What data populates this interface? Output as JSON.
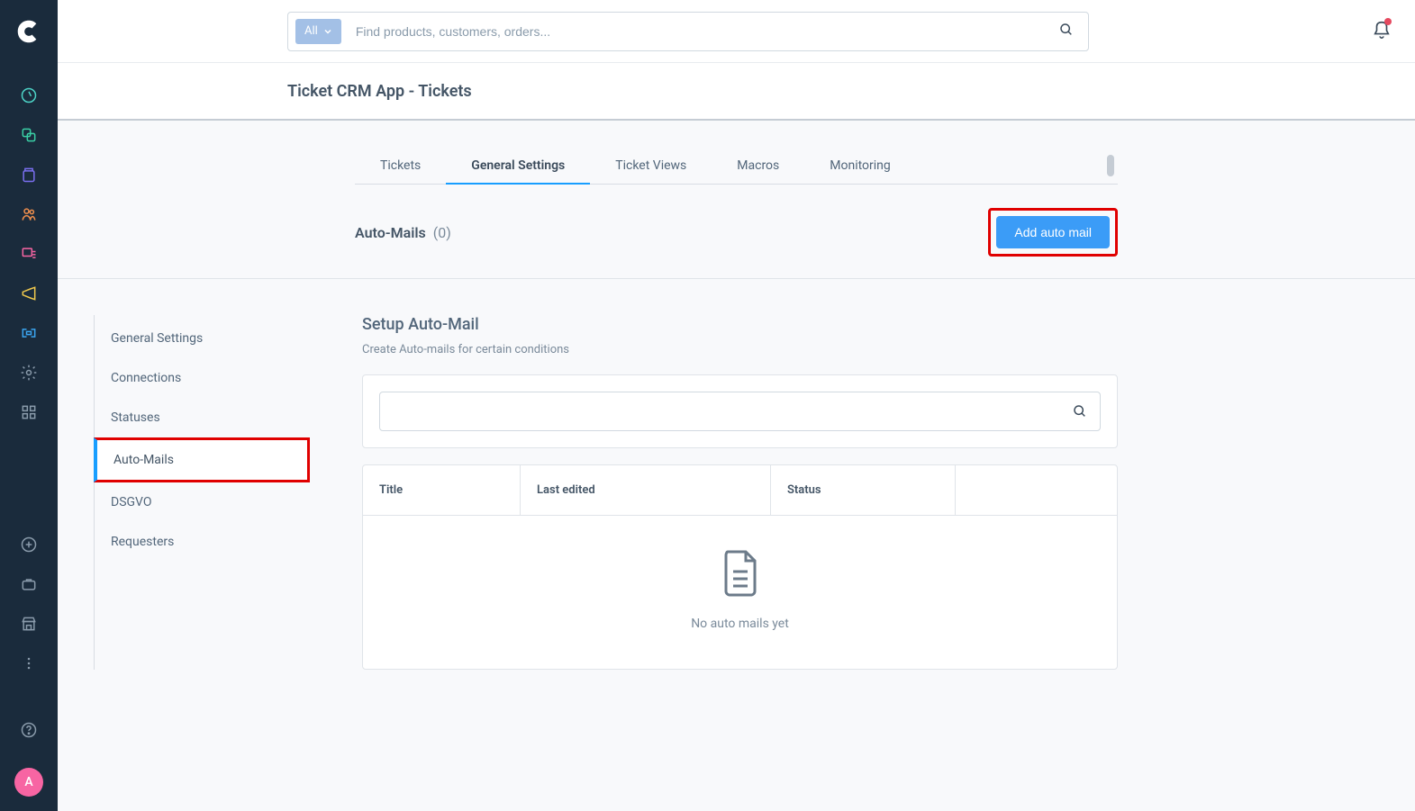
{
  "colors": {
    "sidebar_bg": "#1a2b3c",
    "accent": "#189eff",
    "primary_btn": "#3b9cf7",
    "highlight": "#e00000",
    "avatar_bg": "#f765a3"
  },
  "sidebar": {
    "avatar_letter": "A"
  },
  "topbar": {
    "search_filter_label": "All",
    "search_placeholder": "Find products, customers, orders..."
  },
  "page": {
    "title": "Ticket CRM App - Tickets"
  },
  "tabs": [
    {
      "label": "Tickets",
      "active": false
    },
    {
      "label": "General Settings",
      "active": true
    },
    {
      "label": "Ticket Views",
      "active": false
    },
    {
      "label": "Macros",
      "active": false
    },
    {
      "label": "Monitoring",
      "active": false
    }
  ],
  "section": {
    "title": "Auto-Mails",
    "count": "(0)",
    "add_button": "Add auto mail"
  },
  "settings_nav": [
    {
      "label": "General Settings"
    },
    {
      "label": "Connections"
    },
    {
      "label": "Statuses"
    },
    {
      "label": "Auto-Mails",
      "active": true
    },
    {
      "label": "DSGVO"
    },
    {
      "label": "Requesters"
    }
  ],
  "panel": {
    "heading": "Setup Auto-Mail",
    "sub": "Create Auto-mails for certain conditions",
    "columns": {
      "title": "Title",
      "last_edited": "Last edited",
      "status": "Status"
    },
    "empty_text": "No auto mails yet"
  }
}
